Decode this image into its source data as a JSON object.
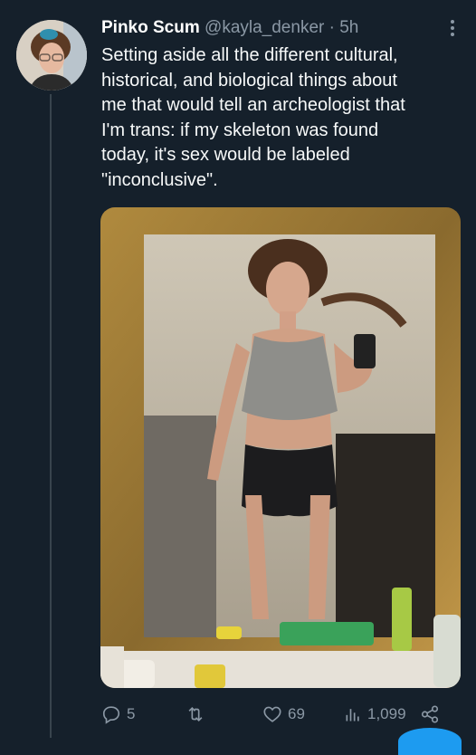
{
  "tweet": {
    "display_name": "Pinko Scum",
    "handle": "@kayla_denker",
    "separator": "·",
    "time": "5h",
    "text": "Setting aside all the different cultural,\nhistorical, and biological things about\nme that would tell an archeologist that\nI'm trans: if my skeleton was found\ntoday, it's sex would be labeled\n\"inconclusive\".",
    "actions": {
      "replies": "5",
      "retweets": "",
      "likes": "69",
      "views": "1,099"
    }
  },
  "icons": {
    "avatar": "profile-photo",
    "more": "more-options-icon",
    "reply": "reply-icon",
    "retweet": "retweet-icon",
    "like": "heart-icon",
    "views": "analytics-icon",
    "share": "share-icon"
  },
  "colors": {
    "background": "#15202b",
    "text": "#f7f9f9",
    "secondary_text": "#8b98a5",
    "thread_line": "#38444d",
    "accent": "#1d9bf0"
  }
}
